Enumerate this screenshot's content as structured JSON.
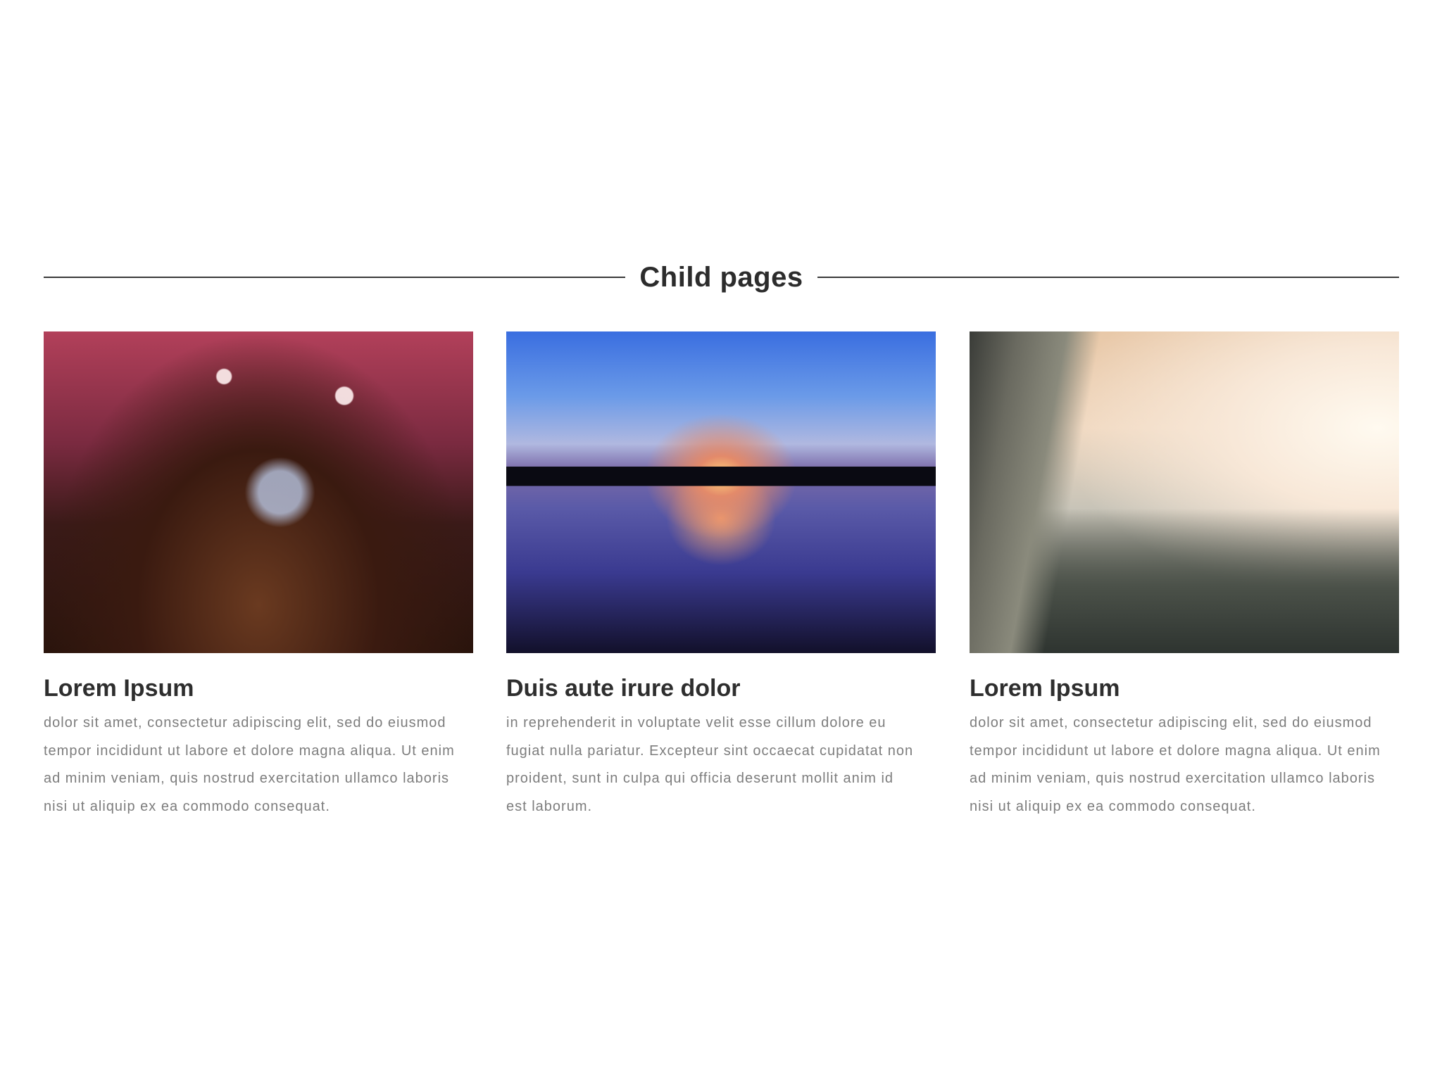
{
  "section": {
    "title": "Child pages"
  },
  "cards": [
    {
      "title": "Lorem Ipsum",
      "image": "concert-crowd-photo",
      "lines": [
        "dolor sit amet, consectetur adipiscing elit, sed do eiusmod",
        "tempor incididunt ut labore et dolore magna aliqua. Ut enim",
        "ad minim veniam, quis nostrud exercitation ullamco laboris",
        "nisi ut aliquip ex ea commodo consequat."
      ]
    },
    {
      "title": "Duis aute irure dolor",
      "image": "sunset-lake-photo",
      "lines": [
        "in reprehenderit in voluptate velit esse cillum dolore eu",
        "fugiat nulla pariatur. Excepteur sint occaecat cupidatat non",
        "proident, sunt in culpa qui officia deserunt mollit anim id",
        "est laborum."
      ]
    },
    {
      "title": "Lorem Ipsum",
      "image": "mountain-valley-photo",
      "lines": [
        "dolor sit amet, consectetur adipiscing elit, sed do eiusmod",
        "tempor incididunt ut labore et dolore magna aliqua. Ut enim",
        "ad minim veniam, quis nostrud exercitation ullamco laboris",
        "nisi ut aliquip ex ea commodo consequat."
      ]
    }
  ]
}
